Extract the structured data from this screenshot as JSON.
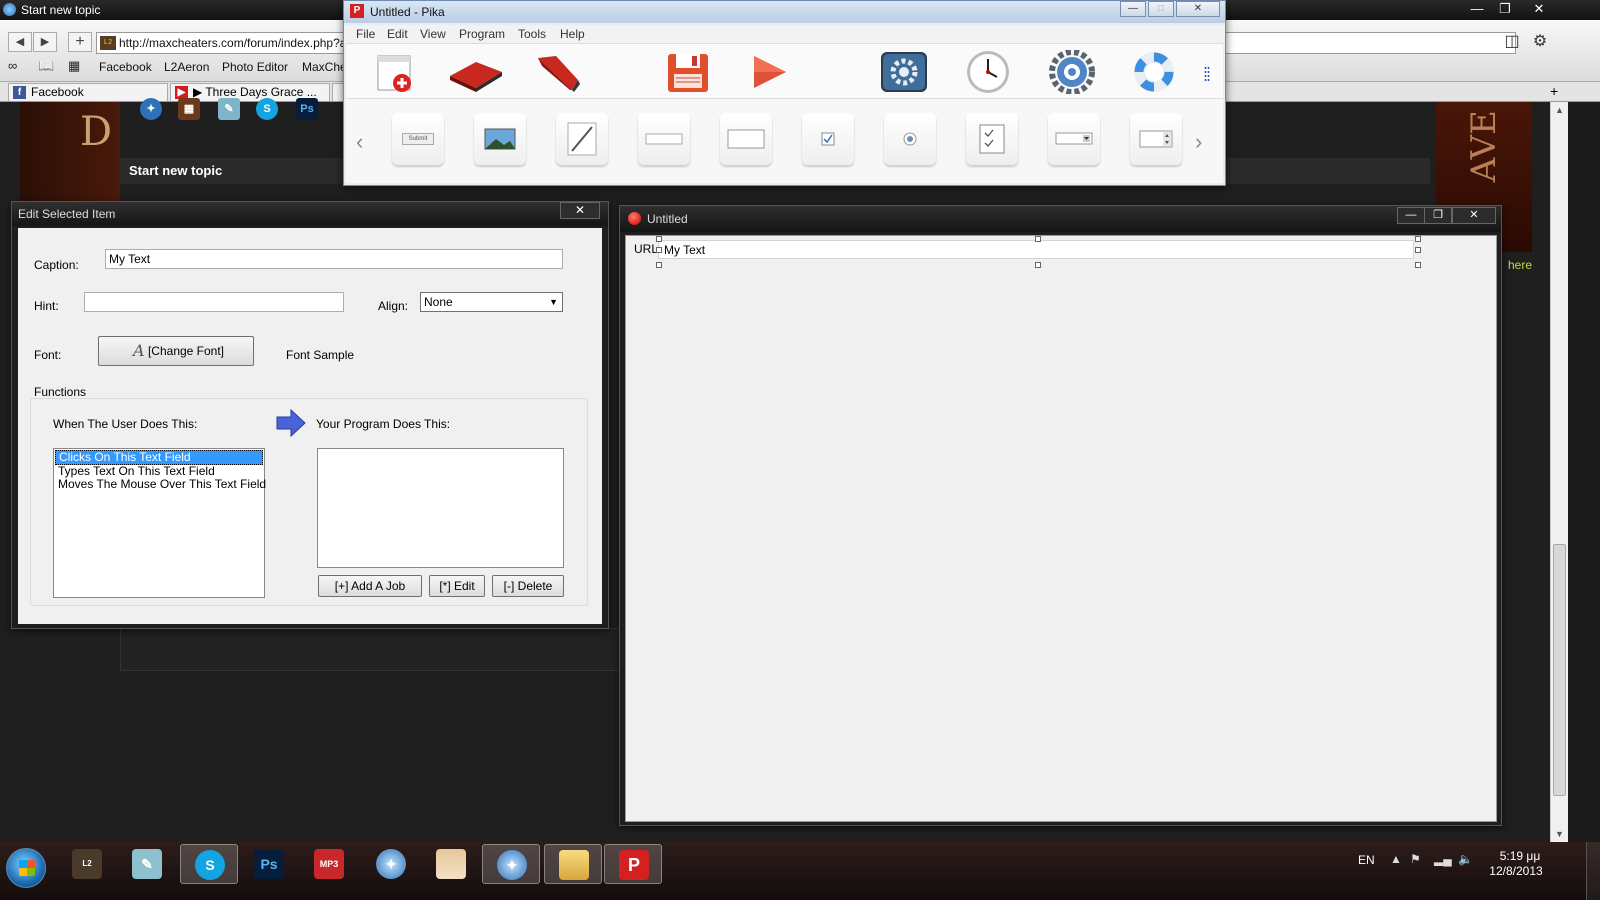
{
  "browser": {
    "tab_title": "Start new topic",
    "address": "http://maxcheaters.com/forum/index.php?a",
    "address_site_icon": "L2",
    "quicklinks": [
      "Facebook",
      "L2Aeron",
      "Photo Editor",
      "MaxChe"
    ],
    "tabs": [
      {
        "label": "Facebook",
        "icon": "facebook-icon"
      },
      {
        "label": "▶ Three Days Grace ...",
        "icon": "youtube-icon"
      }
    ],
    "new_tab_symbol": "+",
    "window_controls": [
      "—",
      "❐",
      "✕"
    ]
  },
  "site": {
    "topic_heading": "Start new topic",
    "here_link": "here",
    "banner_left": "D",
    "banner_right": "AVE"
  },
  "pika": {
    "title": "Untitled - Pika",
    "logo_letter": "P",
    "menu": [
      "File",
      "Edit",
      "View",
      "Program",
      "Tools",
      "Help"
    ],
    "toolbar": [
      "new-form-icon",
      "open-icon",
      "stapler-icon",
      "save-icon",
      "run-icon",
      "settings-icon",
      "clock-icon",
      "gear-icon",
      "help-lifebuoy-icon"
    ],
    "widgets": [
      "button-widget",
      "image-widget",
      "line-widget",
      "textfield-widget",
      "panel-widget",
      "checkbox-widget",
      "radio-widget",
      "checklist-widget",
      "combobox-widget",
      "spinner-widget"
    ],
    "widget_button_text": "Submit"
  },
  "edit_dialog": {
    "title": "Edit Selected Item",
    "close": "✕",
    "caption_label": "Caption:",
    "caption_value": "My Text",
    "hint_label": "Hint:",
    "hint_value": "",
    "align_label": "Align:",
    "align_value": "None",
    "font_label": "Font:",
    "change_font": "[Change Font]",
    "font_sample": "Font Sample",
    "functions_label": "Functions",
    "when_user": "When The User Does This:",
    "your_program": "Your Program Does This:",
    "events": [
      {
        "label": "Clicks On This Text Field",
        "selected": true
      },
      {
        "label": "Types Text On This Text Field",
        "selected": false
      },
      {
        "label": "Moves The Mouse Over This Text Field",
        "selected": false
      }
    ],
    "add_job": "[+]  Add  A Job",
    "edit": "[*]  Edit",
    "delete": "[-]  Delete"
  },
  "form_window": {
    "title": "Untitled",
    "field_label": "URL:",
    "field_value": "My Text",
    "controls": [
      "—",
      "❐",
      "✕"
    ]
  },
  "taskbar": {
    "apps": [
      "lineage-icon",
      "notepad-icon",
      "skype-icon",
      "photoshop-icon",
      "mp3-icon",
      "safari-icon",
      "game-icon",
      "safari-icon",
      "explorer-icon",
      "pika-icon"
    ],
    "language": "EN",
    "time": "5:19 μμ",
    "date": "12/8/2013"
  },
  "colors": {
    "selection": "#3399ff",
    "pika_red": "#d42020",
    "here_link": "#c6d840"
  }
}
